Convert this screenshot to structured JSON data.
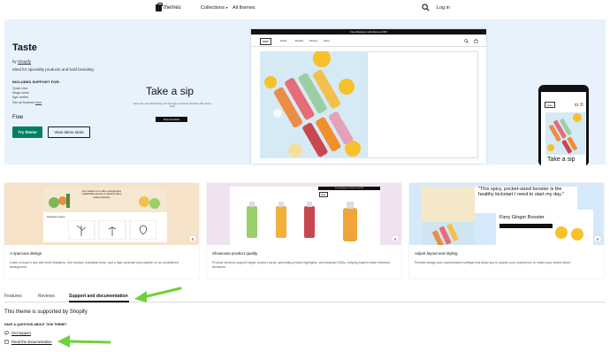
{
  "nav": {
    "brand": "themes",
    "collections": "Collections",
    "all_themes": "All themes",
    "login": "Log in"
  },
  "hero": {
    "title": "Taste",
    "by_prefix": "by",
    "by_vendor": "Shopify",
    "description": "Ideal for speciality products and bold branding",
    "support_heading": "INCLUDES SUPPORT FOR:",
    "features": [
      "Quick view",
      "Mega menu",
      "Age verifier"
    ],
    "see_all_prefix": "See all features",
    "see_all_link": "here",
    "price": "Free",
    "try_button": "Try theme",
    "demo_button": "View demo store"
  },
  "preview": {
    "announcement": "Free shipping on all orders over $70",
    "store_logo": "taste",
    "menu": [
      "Drinks",
      "Bundles",
      "Recipes",
      "About"
    ],
    "headline": "Take a sip",
    "subtext": "Sweet, tart, and mouthwatering. Our beverages, prepared consciously with nature's finest",
    "shop_button": "Shop lemonades",
    "phone_headline": "Take a sip"
  },
  "cards": [
    {
      "title": "A spacious design",
      "desc": "Catch a buyer's eye with bold headlines, thin strokes, industrial fonts, and a high-contrast color palette on an uncluttered background.",
      "inner_text": "Our mission is to offer underground, sustainable access to nature's plant-based vitamins",
      "inner_label": "Keeping it green"
    },
    {
      "title": "Showcase product quality",
      "desc": "Product sections support larger product cards, speciality product highlights, and bespoke FAQs, helping buyers make informed decisions.",
      "inner_bar": "Free shipping on all orders over $70",
      "inner_logo": "taste"
    },
    {
      "title": "Adjust layout and styling",
      "desc": "Flexible design and customization settings that allow you to update your experience to match your brand vision.",
      "quote": "\"This spicy, pocket-sized booster is the healthy kickstart I need to start my day.\"",
      "product": "Fiery Ginger Booster"
    }
  ],
  "tabs": [
    "Features",
    "Reviews",
    "Support and documentation"
  ],
  "support": {
    "statement": "This theme is supported by Shopify",
    "question": "HAVE A QUESTION ABOUT THIS THEME?",
    "get_support": "Get support",
    "read_docs": "Read the documentation"
  },
  "colors": {
    "accent_green": "#008060",
    "hero_bg": "#e8f2fc",
    "annotation_arrow": "#6fd13b"
  }
}
